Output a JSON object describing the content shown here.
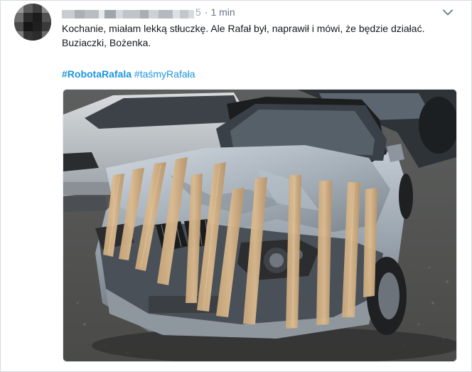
{
  "tweet": {
    "author_tail": "5",
    "separator": "·",
    "timestamp": "1 min",
    "text_line1": "Kochanie, miałam lekką stłuczkę. Ale Rafał był, naprawił i mówi, że będzie działać.",
    "text_line2": "Buziaczki, Bożenka.",
    "hashtags": [
      {
        "label": "#RobotaRafala",
        "bold": true
      },
      {
        "label": "#taśmyRafała",
        "bold": false
      }
    ],
    "media_icon": "photo"
  },
  "icons": {
    "caret": "chevron-down-icon",
    "avatar": "pixelated-avatar"
  },
  "colors": {
    "link": "#1b95e0",
    "text": "#14171a",
    "meta": "#657786",
    "border": "#e1e8ed"
  }
}
